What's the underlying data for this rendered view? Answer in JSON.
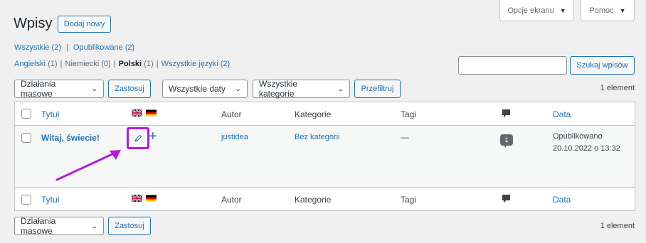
{
  "screen_tabs": {
    "options": "Opcje ekranu",
    "help": "Pomoc"
  },
  "header": {
    "title": "Wpisy",
    "add_new": "Dodaj nowy"
  },
  "status_filter": {
    "all": "Wszystkie (2)",
    "sep": "|",
    "published": "Opublikowane (2)"
  },
  "lang_filter": {
    "english": "Angielski",
    "english_count": "(1)",
    "german": "Niemiecki (0)",
    "polish": "Polski",
    "polish_count": "(1)",
    "all": "Wszystkie języki (2)"
  },
  "search": {
    "button": "Szukaj wpisów",
    "value": ""
  },
  "tablenav_top": {
    "bulk": "Działania masowe",
    "apply": "Zastosuj",
    "dates": "Wszystkie daty",
    "categories": "Wszystkie kategorie",
    "filter": "Przefiltruj",
    "count": "1 element"
  },
  "columns": {
    "title": "Tytuł",
    "author": "Autor",
    "categories": "Kategorie",
    "tags": "Tagi",
    "date": "Data"
  },
  "post": {
    "title": "Witaj, świecie!",
    "author": "justidea",
    "category": "Bez kategorii",
    "tags": "—",
    "comments": "1",
    "status": "Opublikowano",
    "date": "20.10.2022 o 13:32"
  },
  "tablenav_bottom": {
    "bulk": "Działania masowe",
    "apply": "Zastosuj",
    "count": "1 element"
  },
  "colors": {
    "accent": "#2271b1",
    "highlight": "#b31bd9"
  }
}
